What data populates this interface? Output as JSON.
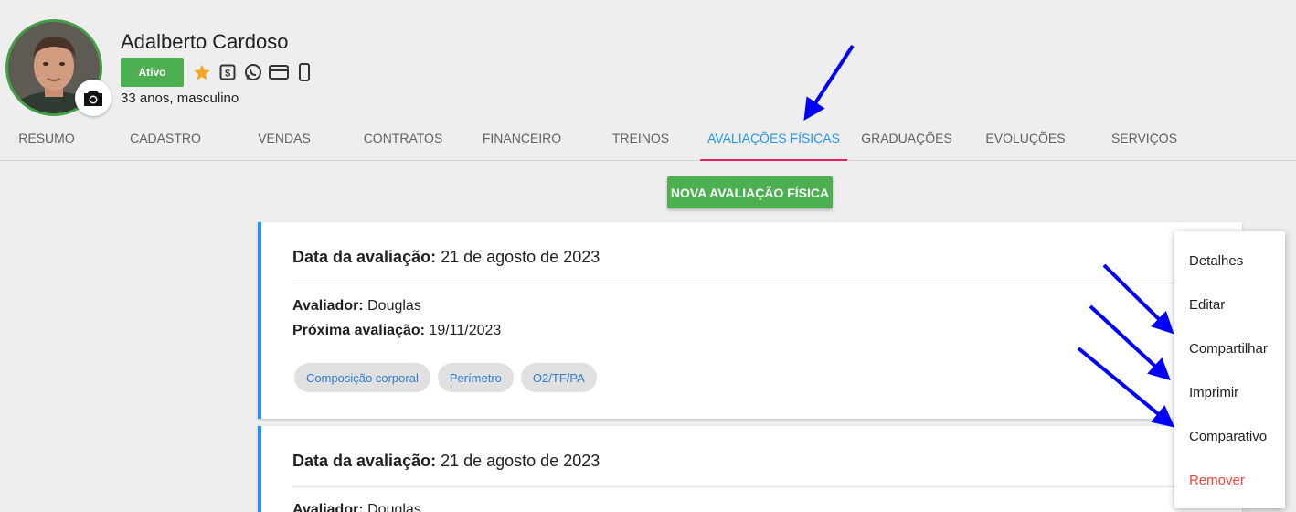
{
  "profile": {
    "name": "Adalberto Cardoso",
    "status_label": "Ativo",
    "meta": "33 anos, masculino",
    "icons": [
      "star-icon",
      "dollar-icon",
      "whatsapp-icon",
      "credit-card-icon",
      "mobile-phone-icon"
    ]
  },
  "tabs": [
    {
      "label": "RESUMO"
    },
    {
      "label": "CADASTRO"
    },
    {
      "label": "VENDAS"
    },
    {
      "label": "CONTRATOS"
    },
    {
      "label": "FINANCEIRO"
    },
    {
      "label": "TREINOS"
    },
    {
      "label": "AVALIAÇÕES FÍSICAS",
      "active": true
    },
    {
      "label": "GRADUAÇÕES"
    },
    {
      "label": "EVOLUÇÕES"
    },
    {
      "label": "SERVIÇOS"
    }
  ],
  "new_evaluation_label": "NOVA AVALIAÇÃO FÍSICA",
  "evaluations": [
    {
      "date_label": "Data da avaliação:",
      "date_value": "21 de agosto de 2023",
      "evaluator_label": "Avaliador:",
      "evaluator_value": "Douglas",
      "next_label": "Próxima avaliação:",
      "next_value": "19/11/2023",
      "chips": [
        "Composição corporal",
        "Perímetro",
        "O2/TF/PA"
      ]
    },
    {
      "date_label": "Data da avaliação:",
      "date_value": "21 de agosto de 2023",
      "evaluator_label": "Avaliador:",
      "evaluator_value": "Douglas"
    }
  ],
  "menu": {
    "items": [
      "Detalhes",
      "Editar",
      "Compartilhar",
      "Imprimir",
      "Comparativo",
      "Remover"
    ]
  },
  "colors": {
    "primary_green": "#4caf50",
    "active_tab_text": "#2196f3",
    "active_tab_indicator": "#e91e63",
    "card_accent": "#2196f3",
    "chip_text": "#2f7dd1",
    "remove_red": "#f44336",
    "annotation_arrow": "#0000ff",
    "star": "#f5a623"
  }
}
